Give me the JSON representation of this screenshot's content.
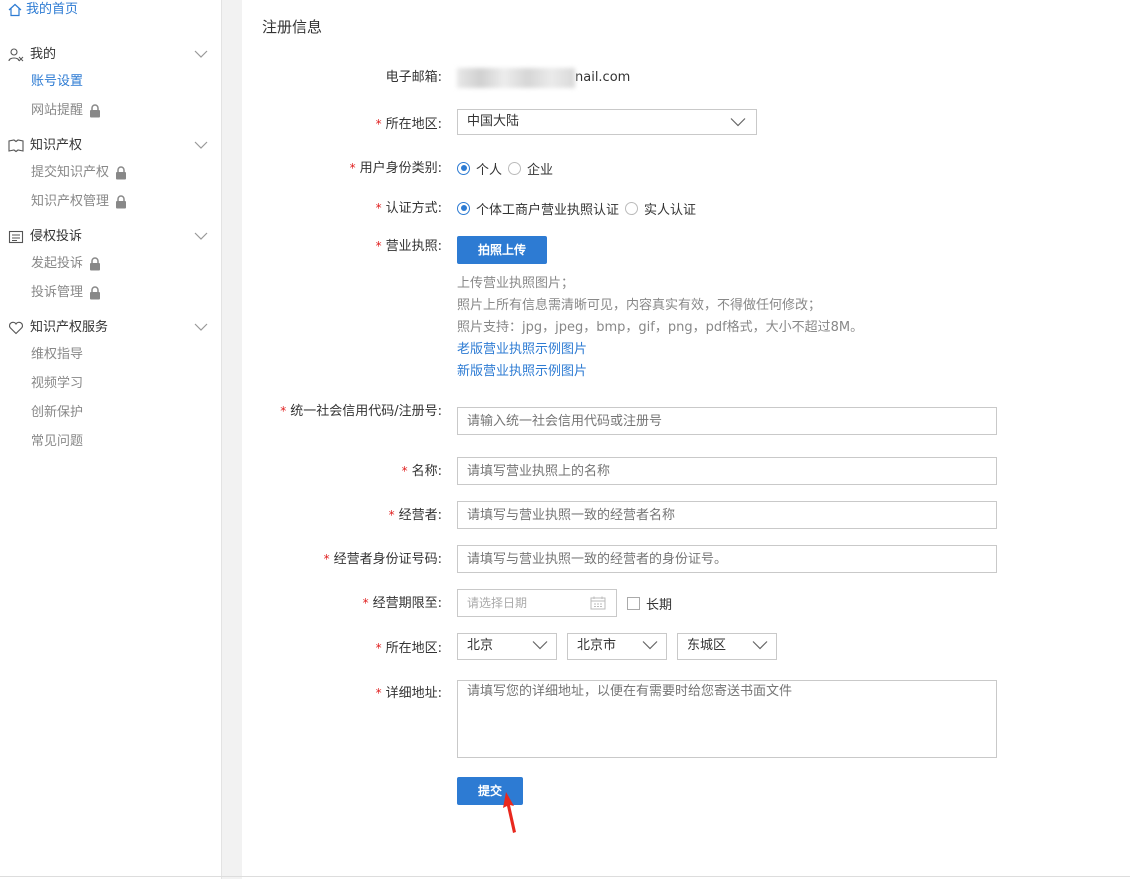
{
  "sidebar": {
    "home_label": "我的首页",
    "sections": [
      {
        "title": "我的",
        "icon": "user-icon",
        "items": [
          {
            "label": "账号设置",
            "active": true,
            "locked": false
          },
          {
            "label": "网站提醒",
            "active": false,
            "locked": true
          }
        ]
      },
      {
        "title": "知识产权",
        "icon": "book-icon",
        "items": [
          {
            "label": "提交知识产权",
            "active": false,
            "locked": true
          },
          {
            "label": "知识产权管理",
            "active": false,
            "locked": true
          }
        ]
      },
      {
        "title": "侵权投诉",
        "icon": "document-icon",
        "items": [
          {
            "label": "发起投诉",
            "active": false,
            "locked": true
          },
          {
            "label": "投诉管理",
            "active": false,
            "locked": true
          }
        ]
      },
      {
        "title": "知识产权服务",
        "icon": "heart-icon",
        "items": [
          {
            "label": "维权指导",
            "active": false,
            "locked": false
          },
          {
            "label": "视频学习",
            "active": false,
            "locked": false
          },
          {
            "label": "创新保护",
            "active": false,
            "locked": false
          },
          {
            "label": "常见问题",
            "active": false,
            "locked": false
          }
        ]
      }
    ]
  },
  "form": {
    "title": "注册信息",
    "required_mark": "*",
    "email": {
      "label": "电子邮箱:",
      "value": "nail.com"
    },
    "region": {
      "label": "所在地区:",
      "value": "中国大陆"
    },
    "identity": {
      "label": "用户身份类别:",
      "options": [
        "个人",
        "企业"
      ],
      "selected": 0
    },
    "auth": {
      "label": "认证方式:",
      "options": [
        "个体工商户营业执照认证",
        "实人认证"
      ],
      "selected": 0
    },
    "license": {
      "label": "营业执照:",
      "upload_button": "拍照上传",
      "hints": [
        "上传营业执照图片；",
        "照片上所有信息需清晰可见，内容真实有效，不得做任何修改；",
        "照片支持：jpg，jpeg，bmp，gif，png，pdf格式，大小不超过8M。"
      ],
      "links": [
        "老版营业执照示例图片",
        "新版营业执照示例图片"
      ]
    },
    "credit_code": {
      "label": "统一社会信用代码/注册号:",
      "placeholder": "请输入统一社会信用代码或注册号"
    },
    "name": {
      "label": "名称:",
      "placeholder": "请填写营业执照上的名称"
    },
    "operator": {
      "label": "经营者:",
      "placeholder": "请填写与营业执照一致的经营者名称"
    },
    "operator_id": {
      "label": "经营者身份证号码:",
      "placeholder": "请填写与营业执照一致的经营者的身份证号。"
    },
    "term": {
      "label": "经营期限至:",
      "placeholder": "请选择日期",
      "long_term_label": "长期"
    },
    "address_region": {
      "label": "所在地区:",
      "province": "北京",
      "city": "北京市",
      "district": "东城区"
    },
    "address": {
      "label": "详细地址:",
      "placeholder": "请填写您的详细地址，以便在有需要时给您寄送书面文件"
    },
    "submit_label": "提交"
  },
  "colors": {
    "accent": "#2d7bd3",
    "required": "#e02020",
    "cursor": "#e8281e"
  }
}
